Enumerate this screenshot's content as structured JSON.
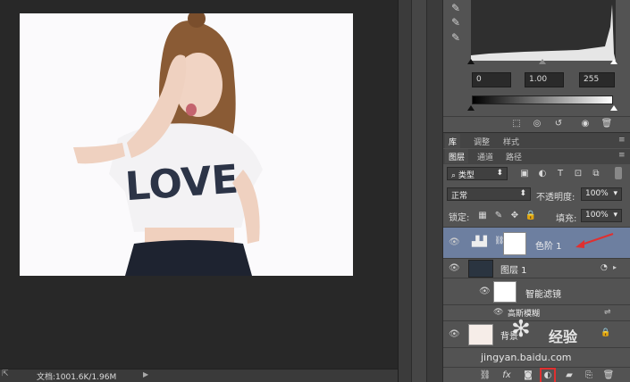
{
  "status": {
    "doc_size": "文档:1001.6K/1.96M"
  },
  "photo": {
    "shirt_text": "LOVE"
  },
  "levels": {
    "input_black": "0",
    "input_gamma": "1.00",
    "input_white": "255"
  },
  "panel_tabs": {
    "library": "库",
    "adjust": "调整",
    "styles": "样式"
  },
  "layer_tabs": {
    "layers": "图层",
    "channels": "通道",
    "paths": "路径"
  },
  "layers_panel": {
    "filter_kind": "类型",
    "blend_mode": "正常",
    "opacity_label": "不透明度:",
    "opacity_value": "100%",
    "lock_label": "锁定:",
    "fill_label": "填充:",
    "fill_value": "100%"
  },
  "layers": [
    {
      "name": "色阶 1"
    },
    {
      "name": "图层 1"
    },
    {
      "name": "智能滤镜"
    },
    {
      "name": "高斯模糊"
    },
    {
      "name": "背景"
    }
  ],
  "watermark": {
    "brand": "经验",
    "url": "jingyan.baidu.com"
  },
  "colors": {
    "selected_layer": "#6d7fa0",
    "annotation_red": "#e03030"
  }
}
